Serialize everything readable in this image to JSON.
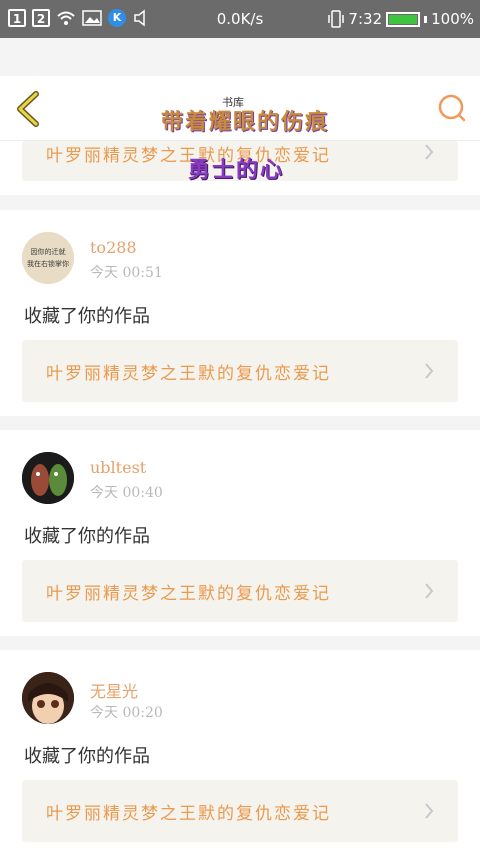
{
  "status_bar": {
    "sim1": "1",
    "sim2": "2",
    "k_label": "K",
    "speed": "0.0K/s",
    "time": "7:32",
    "battery_percent": "100%",
    "battery_level": 1.0,
    "battery_color": "#3ec43e"
  },
  "header": {
    "title_line1": "带着耀眼的伤痕",
    "title_small": "书库",
    "title_line2": "勇士的心",
    "accent_color": "#e7a06a"
  },
  "partial_card": {
    "work_title": "叶罗丽精灵梦之王默的复仇恋爱记"
  },
  "feed": [
    {
      "username": "to288",
      "time": "今天 00:51",
      "avatar_text_line1": "因你的迁就",
      "avatar_text_line2": "我在右锁掌你",
      "message": "收藏了你的作品",
      "work_title": "叶罗丽精灵梦之王默的复仇恋爱记"
    },
    {
      "username": "ubltest",
      "time": "今天 00:40",
      "message": "收藏了你的作品",
      "work_title": "叶罗丽精灵梦之王默的复仇恋爱记"
    },
    {
      "username": "无星光",
      "time": "今天 00:20",
      "message": "收藏了你的作品",
      "work_title": "叶罗丽精灵梦之王默的复仇恋爱记"
    }
  ]
}
